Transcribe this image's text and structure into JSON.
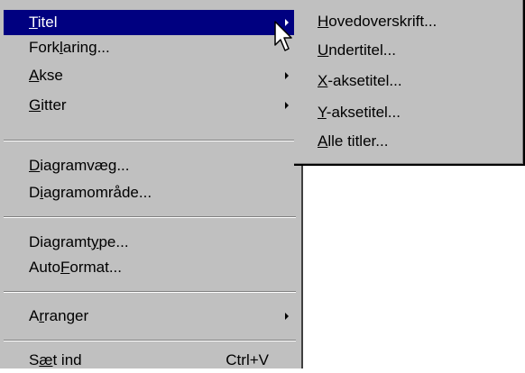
{
  "main_menu": {
    "items": [
      {
        "pre": "",
        "acc": "T",
        "post": "itel",
        "submenu": true,
        "highlighted": true
      },
      {
        "pre": "Fork",
        "acc": "l",
        "post": "aring...",
        "submenu": false
      },
      {
        "pre": "",
        "acc": "A",
        "post": "kse",
        "submenu": true
      },
      {
        "pre": "",
        "acc": "G",
        "post": "itter",
        "submenu": true
      },
      {
        "pre": "",
        "acc": "D",
        "post": "iagramvæg...",
        "submenu": false
      },
      {
        "pre": "D",
        "acc": "i",
        "post": "agramområde...",
        "submenu": false
      },
      {
        "pre": "Diagramt",
        "acc": "y",
        "post": "pe...",
        "submenu": false
      },
      {
        "pre": "Auto",
        "acc": "F",
        "post": "ormat...",
        "submenu": false
      },
      {
        "pre": "A",
        "acc": "r",
        "post": "ranger",
        "submenu": true
      },
      {
        "pre": "S",
        "acc": "æ",
        "post": "t ind",
        "submenu": false,
        "shortcut": "Ctrl+V"
      }
    ]
  },
  "sub_menu": {
    "items": [
      {
        "pre": "",
        "acc": "H",
        "post": "ovedoverskrift..."
      },
      {
        "pre": "",
        "acc": "U",
        "post": "ndertitel..."
      },
      {
        "pre": "",
        "acc": "X",
        "post": "-aksetitel..."
      },
      {
        "pre": "",
        "acc": "Y",
        "post": "-aksetitel..."
      },
      {
        "pre": "",
        "acc": "A",
        "post": "lle titler..."
      }
    ]
  },
  "colors": {
    "menu_bg": "#c0c0c0",
    "highlight": "#000080"
  }
}
